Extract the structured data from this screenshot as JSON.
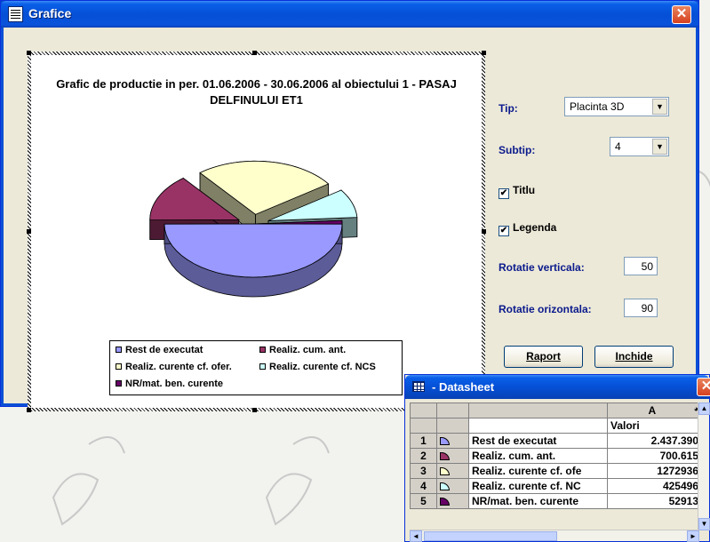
{
  "window": {
    "title": "Grafice",
    "close_glyph": "✕"
  },
  "chart_data": {
    "type": "pie",
    "title": "Grafic de productie in per. 01.06.2006 - 30.06.2006 al obiectului 1 - PASAJ DELFINULUI ET1",
    "categories": [
      "Rest de executat",
      "Realiz. cum. ant.",
      "Realiz. curente cf. ofer.",
      "Realiz. curente cf. NCS",
      "NR/mat. ben. curente"
    ],
    "values": [
      2437390,
      700615,
      1272936,
      425496,
      52913
    ],
    "colors": [
      "#9999ff",
      "#993366",
      "#ffffcc",
      "#ccffff",
      "#660066"
    ],
    "legend_position": "bottom"
  },
  "controls": {
    "tip_label": "Tip:",
    "tip_value": "Placinta 3D",
    "subtip_label": "Subtip:",
    "subtip_value": "4",
    "titlu_label": "Titlu",
    "titlu_checked": true,
    "legenda_label": "Legenda",
    "legenda_checked": true,
    "rot_v_label": "Rotatie verticala:",
    "rot_v_value": "50",
    "rot_h_label": "Rotatie orizontala:",
    "rot_h_value": "90",
    "raport_label": "Raport",
    "inchide_label": "Inchide"
  },
  "datasheet": {
    "title": "- Datasheet",
    "col_letter": "A",
    "col_header": "Valori",
    "rows": [
      {
        "num": "1",
        "label": "Rest de executat",
        "value": "2.437.390"
      },
      {
        "num": "2",
        "label": "Realiz. cum. ant.",
        "value": "700.615"
      },
      {
        "num": "3",
        "label": "Realiz. curente cf. ofe",
        "value": "1272936"
      },
      {
        "num": "4",
        "label": "Realiz. curente cf. NC",
        "value": "425496"
      },
      {
        "num": "5",
        "label": "NR/mat. ben. curente",
        "value": "52913"
      }
    ]
  }
}
